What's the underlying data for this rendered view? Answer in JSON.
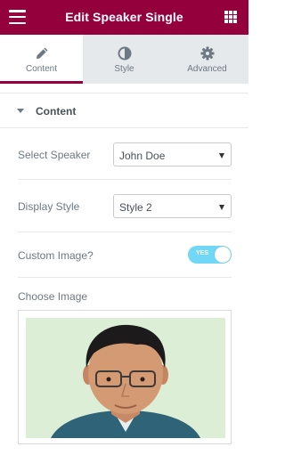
{
  "header": {
    "title": "Edit Speaker Single"
  },
  "tabs": [
    {
      "label": "Content",
      "icon": "pencil-icon",
      "active": true
    },
    {
      "label": "Style",
      "icon": "contrast-icon",
      "active": false
    },
    {
      "label": "Advanced",
      "icon": "gear-icon",
      "active": false
    }
  ],
  "section": {
    "title": "Content"
  },
  "controls": {
    "select_speaker": {
      "label": "Select Speaker",
      "value": "John Doe"
    },
    "display_style": {
      "label": "Display Style",
      "value": "Style 2"
    },
    "custom_image": {
      "label": "Custom Image?",
      "toggle_text": "YES",
      "enabled": true
    },
    "choose_image": {
      "label": "Choose Image"
    }
  },
  "colors": {
    "brand": "#93003c",
    "toggle": "#71d7f7",
    "tabs_bg": "#e6e9ec"
  }
}
